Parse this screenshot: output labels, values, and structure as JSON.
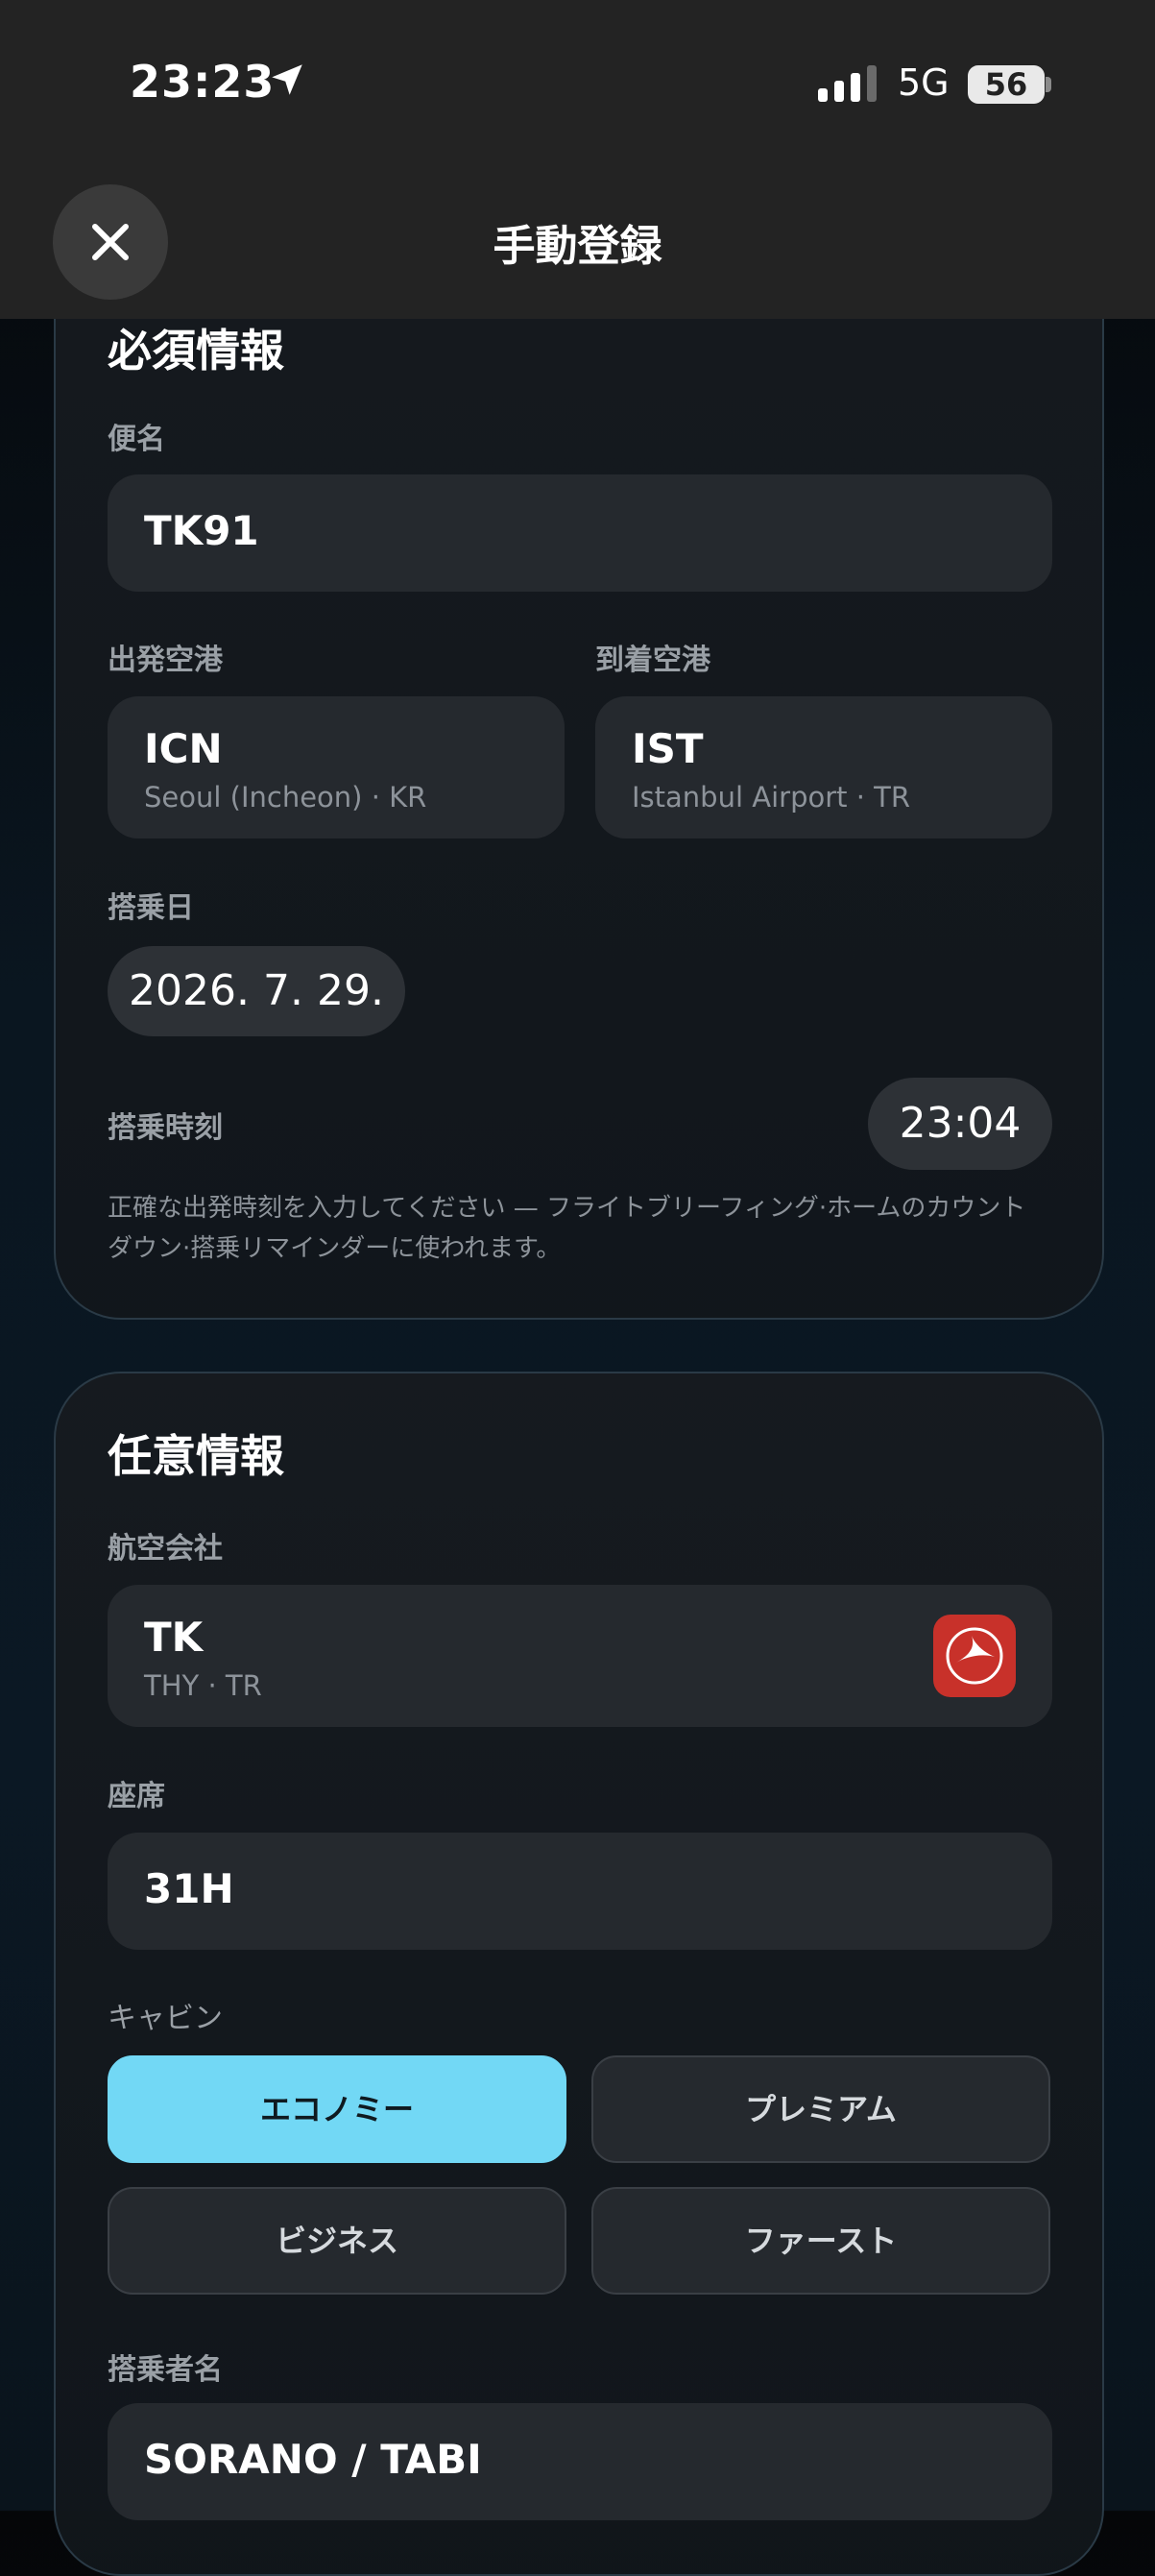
{
  "status_bar": {
    "time": "23:23",
    "network": "5G",
    "battery": "56"
  },
  "nav": {
    "title": "手動登録"
  },
  "required": {
    "title": "必須情報",
    "flight_label": "便名",
    "flight_number": "TK91",
    "departure_label": "出発空港",
    "departure_code": "ICN",
    "departure_name": "Seoul (Incheon) · KR",
    "arrival_label": "到着空港",
    "arrival_code": "IST",
    "arrival_name": "Istanbul Airport · TR",
    "date_label": "搭乗日",
    "date_value": "2026. 7. 29.",
    "time_label": "搭乗時刻",
    "time_value": "23:04",
    "note_line1": "正確な出発時刻を入力してください — フライトブリーフィング·ホームのカウント",
    "note_line2": "ダウン·搭乗リマインダーに使われます。"
  },
  "optional": {
    "title": "任意情報",
    "airline_label": "航空会社",
    "airline_code": "TK",
    "airline_detail": "THY · TR",
    "airline_logo_color": "#c8312a",
    "seat_label": "座席",
    "seat_value": "31H",
    "cabin_label": "キャビン",
    "cabins": [
      "エコノミー",
      "プレミアム",
      "ビジネス",
      "ファースト"
    ],
    "cabin_selected": "エコノミー",
    "accent_color": "#72d8f5",
    "passenger_label": "搭乗者名",
    "passenger_value": "SORANO / TABI"
  }
}
